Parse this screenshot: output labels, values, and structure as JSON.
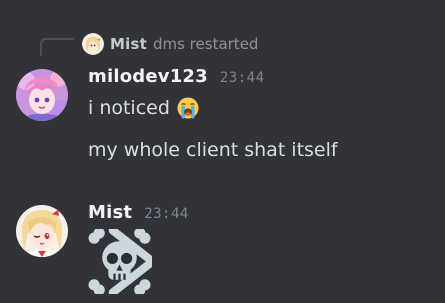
{
  "reply": {
    "author": "Mist",
    "text": "dms restarted"
  },
  "messages": [
    {
      "author": "milodev123",
      "time": "23:44",
      "lines": [
        "i noticed",
        "my whole client shat itself"
      ],
      "emoji": "loudly-crying-face-icon"
    },
    {
      "author": "Mist",
      "time": "23:44",
      "emoji": "skull-and-crossbones-icon"
    }
  ]
}
